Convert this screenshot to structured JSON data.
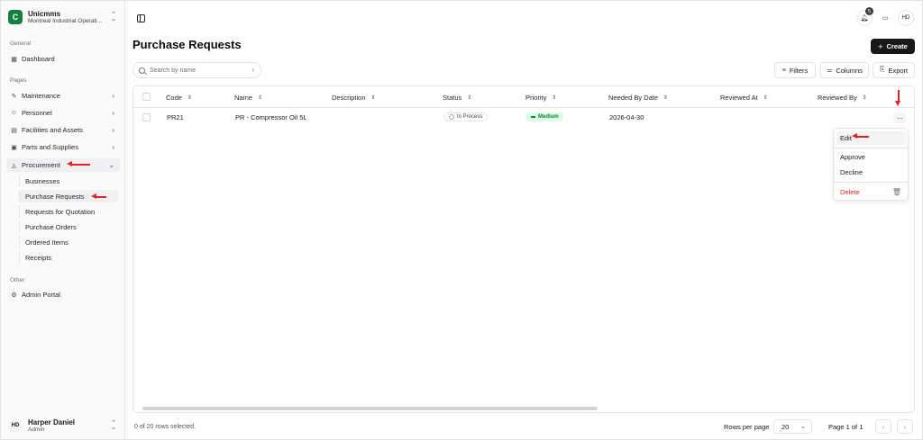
{
  "brand": {
    "name": "Unicmms",
    "subtitle": "Montreal Industrial Operati...",
    "logo_glyph": "C"
  },
  "sidebar": {
    "general_label": "General",
    "pages_label": "Pages",
    "other_label": "Other",
    "dashboard": "Dashboard",
    "items": [
      {
        "label": "Maintenance",
        "icon": "wrench-icon"
      },
      {
        "label": "Personnel",
        "icon": "users-icon"
      },
      {
        "label": "Facilities and Assets",
        "icon": "building-icon"
      },
      {
        "label": "Parts and Supplies",
        "icon": "box-icon"
      },
      {
        "label": "Procurement",
        "icon": "shopping-bag-icon",
        "expanded": true
      }
    ],
    "procurement_sub": [
      "Businesses",
      "Purchase Requests",
      "Requests for Quotation",
      "Purchase Orders",
      "Ordered Items",
      "Receipts"
    ],
    "active_sub": "Purchase Requests",
    "admin_portal": "Admin Portal"
  },
  "user": {
    "initials": "HD",
    "name": "Harper Daniel",
    "role": "Admin"
  },
  "topbar": {
    "notification_count": "5",
    "avatar_initials": "HD"
  },
  "page": {
    "title": "Purchase Requests",
    "create_label": "Create"
  },
  "search": {
    "placeholder": "Search by name",
    "value": ""
  },
  "toolbar": {
    "filters": "Filters",
    "columns": "Columns",
    "export": "Export"
  },
  "table": {
    "columns": [
      "Code",
      "Name",
      "Description",
      "Status",
      "Priority",
      "Needed By Date",
      "Reviewed At",
      "Reviewed By"
    ],
    "rows": [
      {
        "code": "PR21",
        "name": "PR - Compressor Oil 5L",
        "description": "",
        "status": "In Process",
        "priority": "Medium",
        "needed_by": "2026-04-30",
        "reviewed_at": "",
        "reviewed_by": ""
      }
    ]
  },
  "row_menu": {
    "edit": "Edit",
    "approve": "Approve",
    "decline": "Decline",
    "delete": "Delete"
  },
  "footer": {
    "selection": "0 of 20 rows selected.",
    "rows_per_page_label": "Rows per page",
    "rows_per_page_value": "20",
    "page_label": "Page 1 of 1"
  },
  "colors": {
    "brand": "#15803d",
    "primary_button": "#18181b",
    "priority_bg": "#dcfce7",
    "priority_text": "#15803d",
    "danger": "#dc2626",
    "annotation_arrow": "#dc2626"
  }
}
